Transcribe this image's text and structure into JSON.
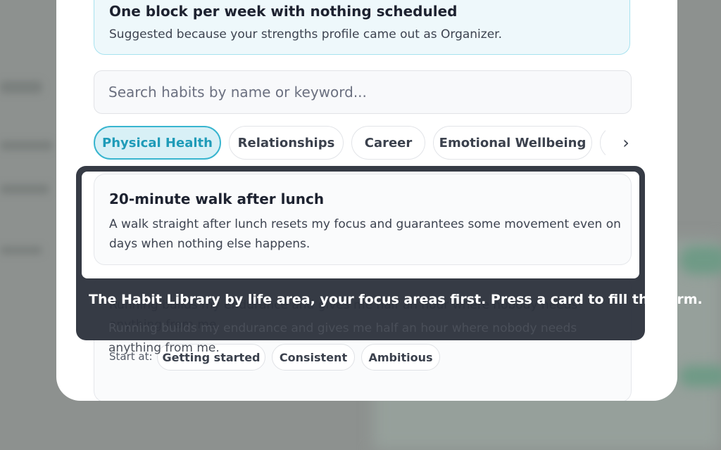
{
  "suggestion": {
    "title": "One block per week with nothing scheduled",
    "subtitle": "Suggested because your strengths profile came out as Organizer."
  },
  "search": {
    "placeholder": "Search habits by name or keyword..."
  },
  "categories": [
    {
      "label": "Physical Health",
      "active": true
    },
    {
      "label": "Relationships",
      "active": false
    },
    {
      "label": "Career",
      "active": false
    },
    {
      "label": "Emotional Wellbeing",
      "active": false
    }
  ],
  "habits": [
    {
      "title": "20-minute walk after lunch",
      "description": "A walk straight after lunch resets my focus and guarantees some movement even on days when nothing else happens."
    },
    {
      "description": "Running builds my endurance and gives me half an hour where nobody needs anything from me.",
      "start_at_label": "Start at:",
      "levels": [
        "Getting started",
        "Consistent",
        "Ambitious"
      ]
    }
  ],
  "coach_mark": {
    "text": "The Habit Library by life area, your focus areas first. Press a card to fill the form."
  },
  "colors": {
    "accent": "#38b5cf",
    "accent_bg": "#d8f0f6",
    "overlay": "#2e333d"
  }
}
